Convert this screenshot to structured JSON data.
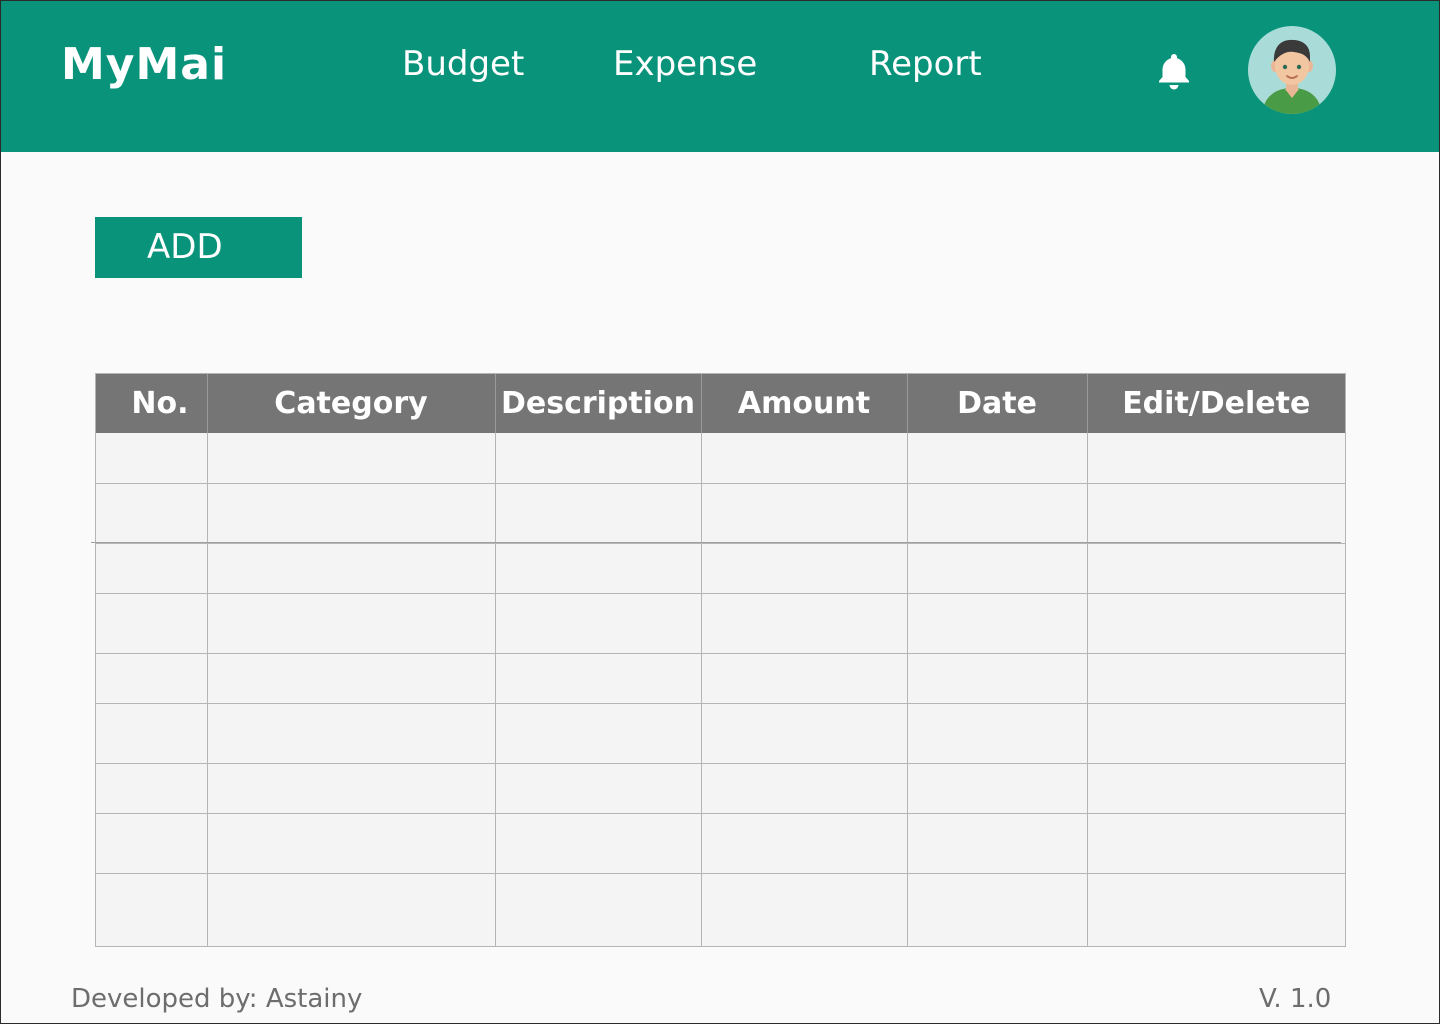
{
  "header": {
    "brand": "MyMai",
    "nav": [
      "Budget",
      "Expense",
      "Report"
    ],
    "icons": {
      "notifications": "bell-icon",
      "profile": "user-avatar"
    }
  },
  "actions": {
    "add_label": "ADD"
  },
  "table": {
    "columns": [
      "No.",
      "Category",
      "Description",
      "Amount",
      "Date",
      "Edit/Delete"
    ],
    "rows": [
      [
        "",
        "",
        "",
        "",
        "",
        ""
      ],
      [
        "",
        "",
        "",
        "",
        "",
        ""
      ],
      [
        "",
        "",
        "",
        "",
        "",
        ""
      ],
      [
        "",
        "",
        "",
        "",
        "",
        ""
      ],
      [
        "",
        "",
        "",
        "",
        "",
        ""
      ],
      [
        "",
        "",
        "",
        "",
        "",
        ""
      ],
      [
        "",
        "",
        "",
        "",
        "",
        ""
      ],
      [
        "",
        "",
        "",
        "",
        "",
        ""
      ],
      [
        "",
        "",
        "",
        "",
        "",
        ""
      ]
    ]
  },
  "footer": {
    "developer": "Developed by: Astainy",
    "version": "V. 1.0"
  },
  "colors": {
    "brand": "#08937a",
    "table_header": "#757575",
    "page_bg": "#fafafa"
  }
}
